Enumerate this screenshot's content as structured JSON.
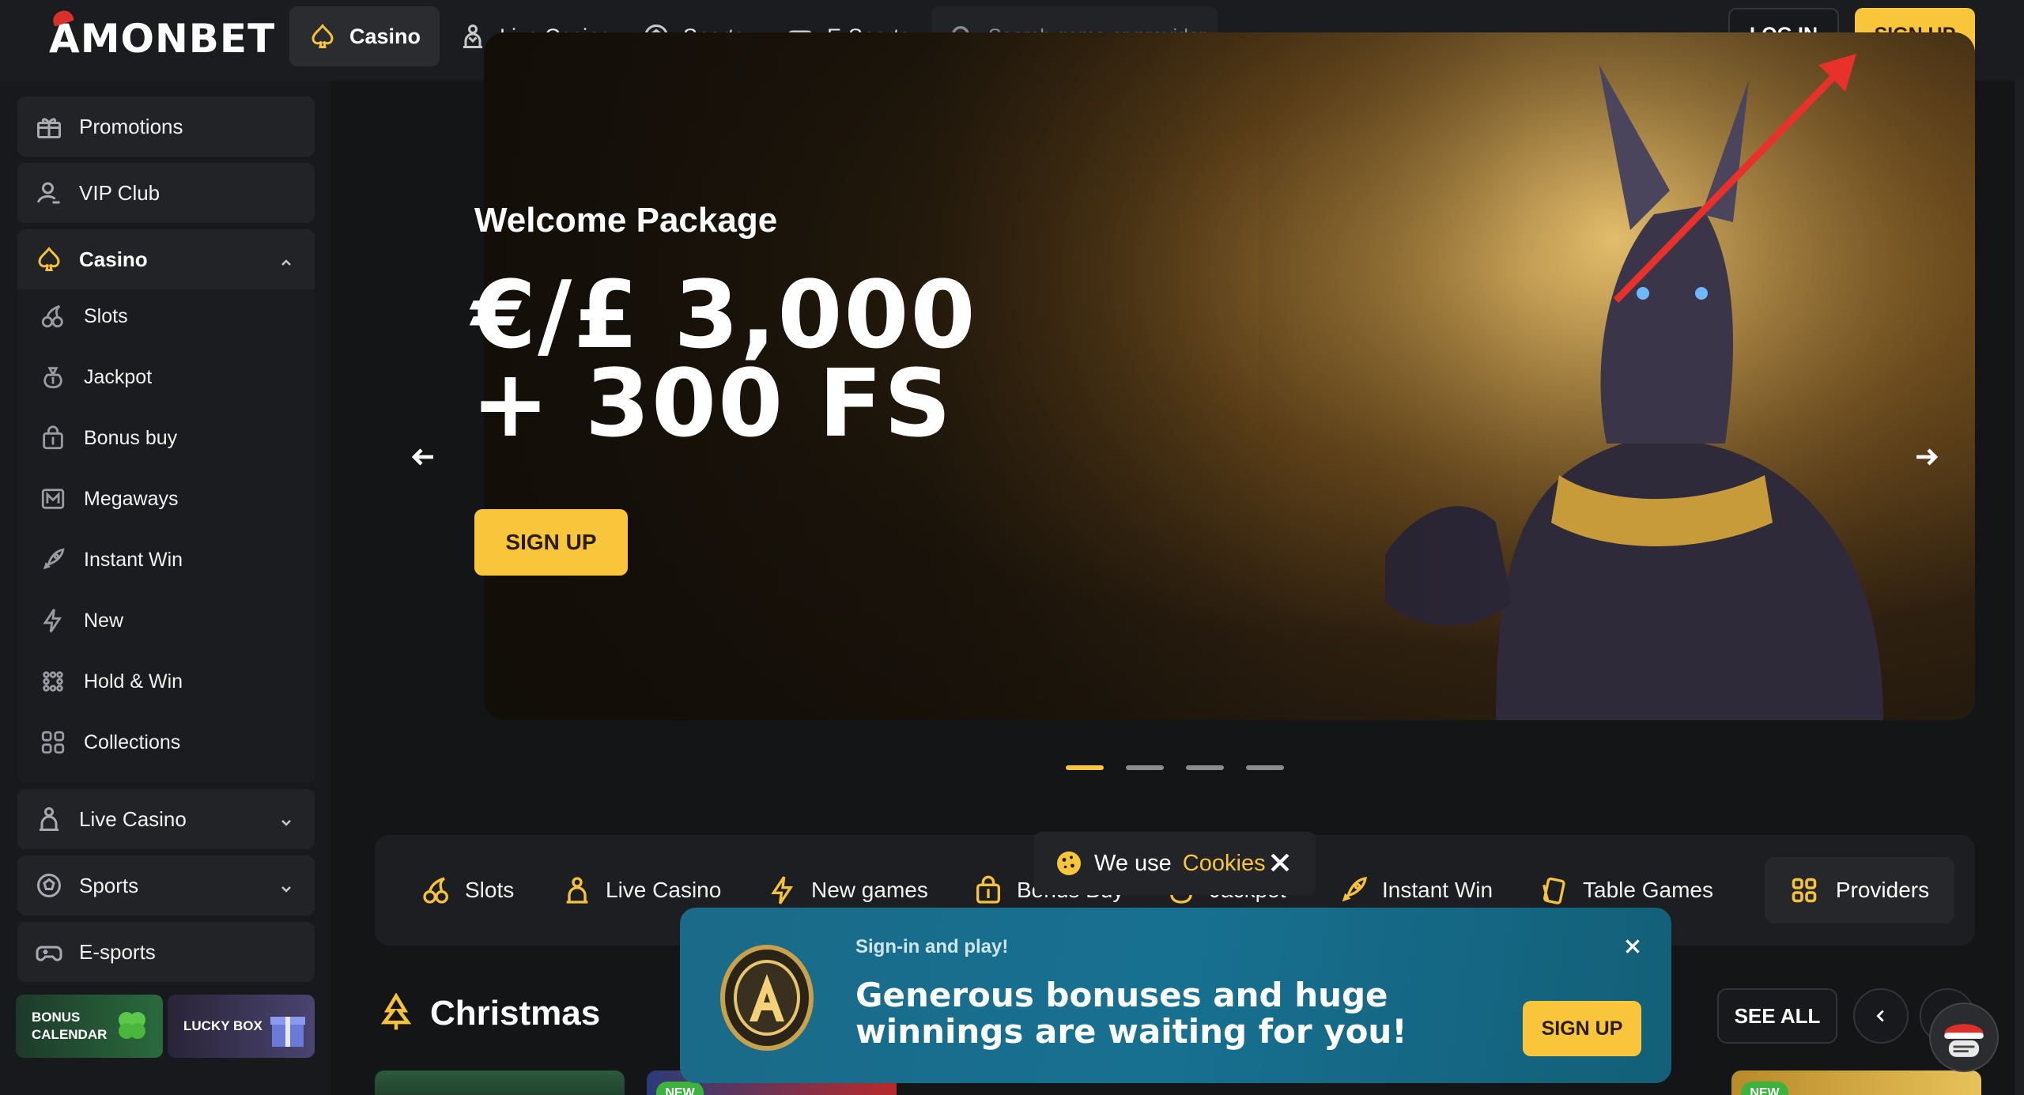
{
  "brand": {
    "logo": "AMONBET"
  },
  "topnav": {
    "items": [
      {
        "label": "Casino",
        "icon": "spade-icon",
        "active": true
      },
      {
        "label": "Live Casino",
        "icon": "dealer-icon"
      },
      {
        "label": "Sports",
        "icon": "soccer-ball-icon"
      },
      {
        "label": "E-Sports",
        "icon": "gamepad-icon"
      }
    ],
    "search_placeholder": "Search game or provider",
    "login": "LOG IN",
    "signup": "SIGN UP"
  },
  "sidebar": {
    "promotions": "Promotions",
    "vip": "VIP Club",
    "casino": "Casino",
    "sub": [
      "Slots",
      "Jackpot",
      "Bonus buy",
      "Megaways",
      "Instant Win",
      "New",
      "Hold & Win",
      "Collections"
    ],
    "live_casino": "Live Casino",
    "sports": "Sports",
    "esports": "E-sports",
    "bonus_calendar": "BONUS CALENDAR",
    "lucky_box": "LUCKY BOX"
  },
  "hero": {
    "subtitle": "Welcome Package",
    "title_line1": "€/£ 3,000",
    "title_line2": "+ 300 FS",
    "button": "SIGN UP",
    "slides": 4,
    "active_slide": 1
  },
  "categories": {
    "items": [
      "Slots",
      "Live Casino",
      "New games",
      "Bonus Buy",
      "Jackpot",
      "Instant Win",
      "Table Games"
    ],
    "providers": "Providers"
  },
  "cookies": {
    "text": "We use",
    "link": "Cookies"
  },
  "section": {
    "title": "Christmas",
    "see_all": "SEE ALL"
  },
  "popup": {
    "small": "Sign-in and play!",
    "big_line1": "Generous bonuses and huge",
    "big_line2": "winnings are waiting for you!",
    "button": "SIGN UP"
  },
  "thumb_badge": "NEW",
  "colors": {
    "accent": "#f8c53b",
    "bg": "#141517",
    "panel": "#222327",
    "popup": "#177090"
  }
}
